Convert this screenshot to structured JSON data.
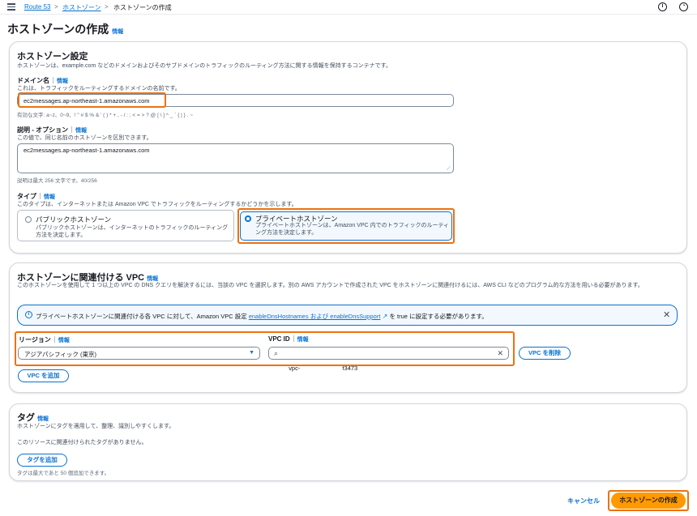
{
  "breadcrumb": {
    "items": [
      "Route 53",
      "ホストゾーン",
      "ホストゾーンの作成"
    ],
    "separator": ">"
  },
  "icons": {
    "menu": "hamburger-icon",
    "info": "info-circle-icon",
    "settings": "gauge-icon"
  },
  "page": {
    "title": "ホストゾーンの作成",
    "info": "情報"
  },
  "config": {
    "title": "ホストゾーン設定",
    "description": "ホストゾーンは、example.com などのドメインおよびそのサブドメインのトラフィックのルーティング方法に関する情報を保持するコンテナです。",
    "domain": {
      "label": "ドメイン名",
      "info": "情報",
      "description": "これは、トラフィックをルーティングするドメインの名前です。",
      "value": "ec2messages.ap-northeast-1.amazonaws.com",
      "hint": "有効な文字: a~z、0~9、! \" # $ % & ' ( ) * + , - / : ; < = > ? @ [ \\ ] ^ _ ` { | } . ~"
    },
    "comment": {
      "label": "説明 - オプション",
      "info": "情報",
      "description": "この値で、同じ名前のホストゾーンを区別できます。",
      "value": "ec2messages.ap-northeast-1.amazonaws.com",
      "hint": "説明は最大 256 文字です。40/256"
    },
    "type": {
      "label": "タイプ",
      "info": "情報",
      "description": "このタイプは、インターネットまたは Amazon VPC でトラフィックをルーティングするかどうかを示します。",
      "options": [
        {
          "label": "パブリックホストゾーン",
          "description": "パブリックホストゾーンは、インターネットのトラフィックのルーティング方法を決定します。",
          "selected": false
        },
        {
          "label": "プライベートホストゾーン",
          "description": "プライベートホストゾーンは、Amazon VPC 内でのトラフィックのルーティング方法を決定します。",
          "selected": true
        }
      ]
    }
  },
  "vpc": {
    "title": "ホストゾーンに関連付ける VPC",
    "info": "情報",
    "description": "このホストゾーンを使用して 1 つ以上の VPC の DNS クエリを解決するには、当該の VPC を選択します。別の AWS アカウントで作成された VPC をホストゾーンに関連付けるには、AWS CLI などのプログラム的な方法を用いる必要があります。",
    "alert": {
      "prefix": "プライベートホストゾーンに関連付ける各 VPC に対して、Amazon VPC 設定",
      "link": "enableDnsHostnames および enableDnsSupport",
      "suffix": "を true に設定する必要があります。"
    },
    "region": {
      "label": "リージョン",
      "info": "情報",
      "value": "アジアパシフィック (東京)"
    },
    "vpc_id": {
      "label": "VPC ID",
      "info": "情報",
      "value": "vpc-                         f3473"
    },
    "remove_button": "VPC を削除",
    "add_button": "VPC を追加"
  },
  "tags": {
    "title": "タグ",
    "info": "情報",
    "description": "ホストゾーンにタグを適用して、整理、識別しやすくします。",
    "empty": "このリソースに関連付けられたタグがありません。",
    "add_button": "タグを追加",
    "hint": "タグは最大であと 50 個追加できます。"
  },
  "footer": {
    "cancel": "キャンセル",
    "create": "ホストゾーンの作成"
  },
  "colors": {
    "accent": "#0972d3",
    "highlight": "#ec7211",
    "primary": "#ff9900"
  }
}
